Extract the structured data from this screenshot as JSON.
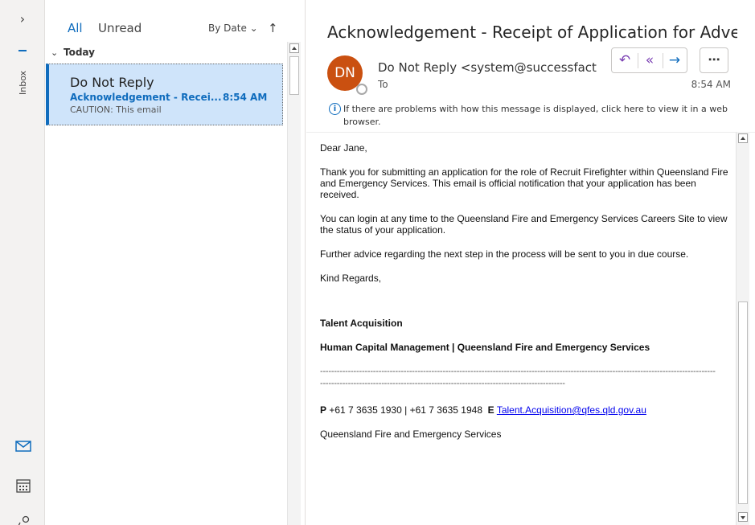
{
  "rail": {
    "expand_glyph": "›",
    "inbox_label": "Inbox",
    "icons": [
      "mail-icon",
      "calendar-icon",
      "people-icon"
    ]
  },
  "list": {
    "tab_all": "All",
    "tab_unread": "Unread",
    "sort_label": "By Date ⌄",
    "sort_dir": "↑",
    "group_label": "Today",
    "group_chevron": "⌄",
    "messages": [
      {
        "sender": "Do Not Reply",
        "subject": "Acknowledgement - Recei...",
        "time": "8:54 AM",
        "preview": "CAUTION: This email"
      }
    ]
  },
  "reading": {
    "title": "Acknowledgement - Receipt of Application for Adverti...",
    "avatar_initials": "DN",
    "from": "Do Not Reply <system@successfactors",
    "to_label": "To",
    "sent_time": "8:54 AM",
    "info_text": "If there are problems with how this message is displayed, click here to view it in a web browser.",
    "body": {
      "greeting": "Dear Jane,",
      "p1": "Thank you for submitting an application for the role of Recruit Firefighter within Queensland Fire and Emergency Services. This email is official notification that your application has been received.",
      "p2": "You can login at any time to the Queensland Fire and Emergency Services Careers Site to view the status of your application.",
      "p3": "Further advice regarding the next step in the process will be sent to you in due course.",
      "signoff": "Kind Regards,",
      "sig_name": "Talent Acquisition",
      "sig_dept": "Human Capital Management | Queensland Fire and Emergency Services",
      "rule": "----------------------------------------------------------------------------------------------------------------------------------------------",
      "rule2": "----------------------------------------------------------------------------------------",
      "phone_label": "P",
      "phones": "+61 7 3635 1930   |  +61 7 3635 1948",
      "email_label": "E",
      "email": "Talent.Acquisition@qfes.qld.gov.au",
      "org": "Queensland Fire and Emergency Services"
    }
  },
  "colors": {
    "accent": "#0f6cbd",
    "avatar": "#ca5010",
    "selected_row": "#cfe4fa",
    "reply_icon": "#7a3fb3"
  }
}
